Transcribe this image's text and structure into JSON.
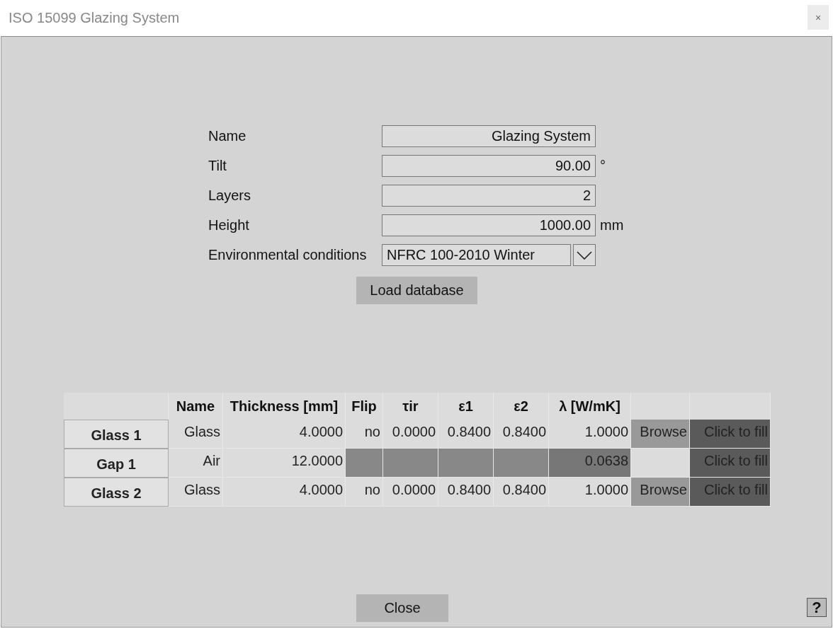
{
  "window": {
    "title": "ISO 15099 Glazing System",
    "close": "×"
  },
  "form": [
    {
      "label": "Name",
      "value": "Glazing System",
      "kind": "text"
    },
    {
      "label": "Tilt",
      "value": "90.00",
      "unit": "°",
      "kind": "text"
    },
    {
      "label": "Layers",
      "value": "2",
      "kind": "text"
    },
    {
      "label": "Height",
      "value": "1000.00",
      "unit": "mm",
      "kind": "text"
    },
    {
      "label": "Environmental conditions",
      "value": "NFRC 100-2010 Winter",
      "kind": "dropdown"
    }
  ],
  "load_button": "Load database",
  "table": {
    "columns": [
      "Name",
      "Thickness [mm]",
      "Flip",
      "τir",
      "ε1",
      "ε2",
      "λ [W/mK]"
    ],
    "rows": [
      {
        "header": "Glass 1",
        "cells": [
          {
            "text": "Glass",
            "kind": "plain"
          },
          {
            "text": "4.0000",
            "kind": "plain"
          },
          {
            "text": "no",
            "kind": "plain"
          },
          {
            "text": "0.0000",
            "kind": "plain"
          },
          {
            "text": "0.8400",
            "kind": "plain"
          },
          {
            "text": "0.8400",
            "kind": "plain"
          },
          {
            "text": "1.0000",
            "kind": "plain"
          },
          {
            "text": "Browse",
            "kind": "browse"
          },
          {
            "text": "Click to fill",
            "kind": "fill"
          }
        ]
      },
      {
        "header": "Gap 1",
        "cells": [
          {
            "text": "Air",
            "kind": "plain"
          },
          {
            "text": "12.0000",
            "kind": "plain"
          },
          {
            "kind": "disabled"
          },
          {
            "kind": "disabled"
          },
          {
            "kind": "disabled"
          },
          {
            "kind": "disabled"
          },
          {
            "text": "0.0638",
            "kind": "dark"
          },
          {
            "kind": "empty"
          },
          {
            "text": "Click to fill",
            "kind": "fill"
          }
        ]
      },
      {
        "header": "Glass 2",
        "cells": [
          {
            "text": "Glass",
            "kind": "plain"
          },
          {
            "text": "4.0000",
            "kind": "plain"
          },
          {
            "text": "no",
            "kind": "plain"
          },
          {
            "text": "0.0000",
            "kind": "plain"
          },
          {
            "text": "0.8400",
            "kind": "plain"
          },
          {
            "text": "0.8400",
            "kind": "plain"
          },
          {
            "text": "1.0000",
            "kind": "plain"
          },
          {
            "text": "Browse",
            "kind": "browse"
          },
          {
            "text": "Click to fill",
            "kind": "fill"
          }
        ]
      }
    ]
  },
  "close_button": "Close",
  "help": "?"
}
